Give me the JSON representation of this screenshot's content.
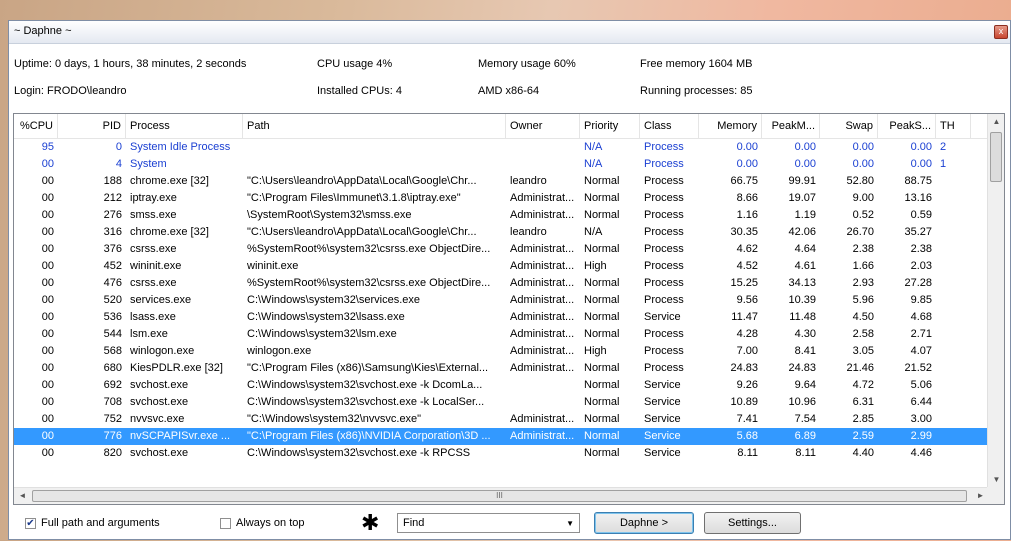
{
  "window": {
    "title": "~ Daphne ~",
    "close_glyph": "x"
  },
  "info": {
    "uptime": "Uptime: 0 days,  1 hours, 38 minutes,  2 seconds",
    "cpu_usage": "CPU usage  4%",
    "memory_usage": "Memory usage  60%",
    "free_memory": "Free memory 1604 MB",
    "login": "Login: FRODO\\leandro",
    "installed_cpus": "Installed CPUs:  4",
    "arch": "AMD x86-64",
    "running_processes": "Running processes:  85"
  },
  "columns": [
    "%CPU",
    "PID",
    "Process",
    "Path",
    "Owner",
    "Priority",
    "Class",
    "Memory",
    "PeakM...",
    "Swap",
    "PeakS...",
    "TH"
  ],
  "rows": [
    {
      "cpu": "95",
      "pid": "0",
      "process": "System Idle Process",
      "path": "",
      "owner": "",
      "priority": "N/A",
      "class": "Process",
      "memory": "0.00",
      "peakm": "0.00",
      "swap": "0.00",
      "peaks": "0.00",
      "th": "2",
      "style": "blue"
    },
    {
      "cpu": "00",
      "pid": "4",
      "process": "System",
      "path": "",
      "owner": "",
      "priority": "N/A",
      "class": "Process",
      "memory": "0.00",
      "peakm": "0.00",
      "swap": "0.00",
      "peaks": "0.00",
      "th": "1",
      "style": "blue"
    },
    {
      "cpu": "00",
      "pid": "188",
      "process": "chrome.exe [32]",
      "path": "\"C:\\Users\\leandro\\AppData\\Local\\Google\\Chr...",
      "owner": "leandro",
      "priority": "Normal",
      "class": "Process",
      "memory": "66.75",
      "peakm": "99.91",
      "swap": "52.80",
      "peaks": "88.75",
      "th": "",
      "style": ""
    },
    {
      "cpu": "00",
      "pid": "212",
      "process": "iptray.exe",
      "path": "\"C:\\Program Files\\Immunet\\3.1.8\\iptray.exe\"",
      "owner": "Administrat...",
      "priority": "Normal",
      "class": "Process",
      "memory": "8.66",
      "peakm": "19.07",
      "swap": "9.00",
      "peaks": "13.16",
      "th": "",
      "style": ""
    },
    {
      "cpu": "00",
      "pid": "276",
      "process": "smss.exe",
      "path": "\\SystemRoot\\System32\\smss.exe",
      "owner": "Administrat...",
      "priority": "Normal",
      "class": "Process",
      "memory": "1.16",
      "peakm": "1.19",
      "swap": "0.52",
      "peaks": "0.59",
      "th": "",
      "style": ""
    },
    {
      "cpu": "00",
      "pid": "316",
      "process": "chrome.exe [32]",
      "path": "\"C:\\Users\\leandro\\AppData\\Local\\Google\\Chr...",
      "owner": "leandro",
      "priority": "N/A",
      "class": "Process",
      "memory": "30.35",
      "peakm": "42.06",
      "swap": "26.70",
      "peaks": "35.27",
      "th": "",
      "style": ""
    },
    {
      "cpu": "00",
      "pid": "376",
      "process": "csrss.exe",
      "path": "%SystemRoot%\\system32\\csrss.exe ObjectDire...",
      "owner": "Administrat...",
      "priority": "Normal",
      "class": "Process",
      "memory": "4.62",
      "peakm": "4.64",
      "swap": "2.38",
      "peaks": "2.38",
      "th": "",
      "style": ""
    },
    {
      "cpu": "00",
      "pid": "452",
      "process": "wininit.exe",
      "path": "wininit.exe",
      "owner": "Administrat...",
      "priority": "High",
      "class": "Process",
      "memory": "4.52",
      "peakm": "4.61",
      "swap": "1.66",
      "peaks": "2.03",
      "th": "",
      "style": ""
    },
    {
      "cpu": "00",
      "pid": "476",
      "process": "csrss.exe",
      "path": "%SystemRoot%\\system32\\csrss.exe ObjectDire...",
      "owner": "Administrat...",
      "priority": "Normal",
      "class": "Process",
      "memory": "15.25",
      "peakm": "34.13",
      "swap": "2.93",
      "peaks": "27.28",
      "th": "",
      "style": ""
    },
    {
      "cpu": "00",
      "pid": "520",
      "process": "services.exe",
      "path": "C:\\Windows\\system32\\services.exe",
      "owner": "Administrat...",
      "priority": "Normal",
      "class": "Process",
      "memory": "9.56",
      "peakm": "10.39",
      "swap": "5.96",
      "peaks": "9.85",
      "th": "",
      "style": ""
    },
    {
      "cpu": "00",
      "pid": "536",
      "process": "lsass.exe",
      "path": "C:\\Windows\\system32\\lsass.exe",
      "owner": "Administrat...",
      "priority": "Normal",
      "class": "Service",
      "memory": "11.47",
      "peakm": "11.48",
      "swap": "4.50",
      "peaks": "4.68",
      "th": "",
      "style": ""
    },
    {
      "cpu": "00",
      "pid": "544",
      "process": "lsm.exe",
      "path": "C:\\Windows\\system32\\lsm.exe",
      "owner": "Administrat...",
      "priority": "Normal",
      "class": "Process",
      "memory": "4.28",
      "peakm": "4.30",
      "swap": "2.58",
      "peaks": "2.71",
      "th": "",
      "style": ""
    },
    {
      "cpu": "00",
      "pid": "568",
      "process": "winlogon.exe",
      "path": "winlogon.exe",
      "owner": "Administrat...",
      "priority": "High",
      "class": "Process",
      "memory": "7.00",
      "peakm": "8.41",
      "swap": "3.05",
      "peaks": "4.07",
      "th": "",
      "style": ""
    },
    {
      "cpu": "00",
      "pid": "680",
      "process": "KiesPDLR.exe [32]",
      "path": "\"C:\\Program Files (x86)\\Samsung\\Kies\\External...",
      "owner": "Administrat...",
      "priority": "Normal",
      "class": "Process",
      "memory": "24.83",
      "peakm": "24.83",
      "swap": "21.46",
      "peaks": "21.52",
      "th": "",
      "style": ""
    },
    {
      "cpu": "00",
      "pid": "692",
      "process": "svchost.exe",
      "path": "C:\\Windows\\system32\\svchost.exe -k DcomLa...",
      "owner": "",
      "priority": "Normal",
      "class": "Service",
      "memory": "9.26",
      "peakm": "9.64",
      "swap": "4.72",
      "peaks": "5.06",
      "th": "",
      "style": ""
    },
    {
      "cpu": "00",
      "pid": "708",
      "process": "svchost.exe",
      "path": "C:\\Windows\\system32\\svchost.exe -k LocalSer...",
      "owner": "",
      "priority": "Normal",
      "class": "Service",
      "memory": "10.89",
      "peakm": "10.96",
      "swap": "6.31",
      "peaks": "6.44",
      "th": "",
      "style": ""
    },
    {
      "cpu": "00",
      "pid": "752",
      "process": "nvvsvc.exe",
      "path": "\"C:\\Windows\\system32\\nvvsvc.exe\"",
      "owner": "Administrat...",
      "priority": "Normal",
      "class": "Service",
      "memory": "7.41",
      "peakm": "7.54",
      "swap": "2.85",
      "peaks": "3.00",
      "th": "",
      "style": ""
    },
    {
      "cpu": "00",
      "pid": "776",
      "process": "nvSCPAPISvr.exe ...",
      "path": "\"C:\\Program Files (x86)\\NVIDIA Corporation\\3D ...",
      "owner": "Administrat...",
      "priority": "Normal",
      "class": "Service",
      "memory": "5.68",
      "peakm": "6.89",
      "swap": "2.59",
      "peaks": "2.99",
      "th": "",
      "style": "selected"
    },
    {
      "cpu": "00",
      "pid": "820",
      "process": "svchost.exe",
      "path": "C:\\Windows\\system32\\svchost.exe -k RPCSS",
      "owner": "",
      "priority": "Normal",
      "class": "Service",
      "memory": "8.11",
      "peakm": "8.11",
      "swap": "4.40",
      "peaks": "4.46",
      "th": "",
      "style": ""
    }
  ],
  "scroll": {
    "h_grip": "III",
    "up": "▲",
    "down": "▼",
    "left": "◄",
    "right": "►"
  },
  "bottom": {
    "full_path_label": "Full path and arguments",
    "full_path_checked": true,
    "always_on_top_label": "Always on top",
    "always_on_top_checked": false,
    "finder_glyph": "✱",
    "find_value": "Find",
    "daphne_button": "Daphne >",
    "settings_button": "Settings..."
  },
  "colors": {
    "selection": "#3399ff",
    "system_row_text": "#1a3fd2"
  }
}
